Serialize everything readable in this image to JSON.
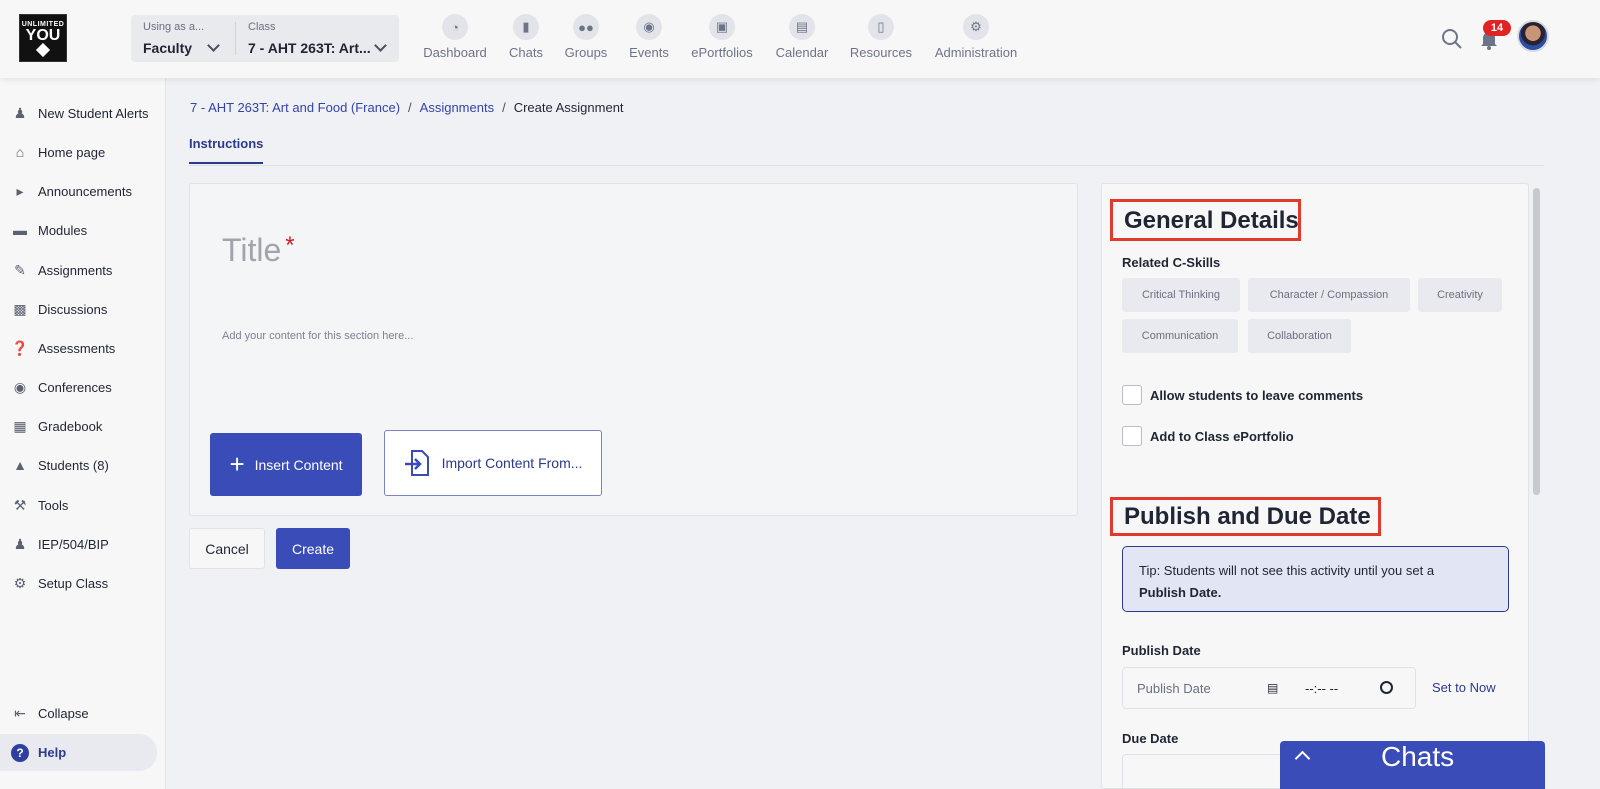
{
  "logo": {
    "line1": "UNLIMITED",
    "line2": "YOU"
  },
  "role_select": {
    "label": "Using as a...",
    "value": "Faculty"
  },
  "class_select": {
    "label": "Class",
    "value": "7 - AHT 263T: Art..."
  },
  "nav": [
    {
      "label": "Dashboard",
      "icon": "gauge-icon"
    },
    {
      "label": "Chats",
      "icon": "chat-icon"
    },
    {
      "label": "Groups",
      "icon": "groups-icon"
    },
    {
      "label": "Events",
      "icon": "pin-icon"
    },
    {
      "label": "ePortfolios",
      "icon": "portfolio-icon"
    },
    {
      "label": "Calendar",
      "icon": "calendar-icon"
    },
    {
      "label": "Resources",
      "icon": "books-icon"
    },
    {
      "label": "Administration",
      "icon": "gears-icon"
    }
  ],
  "notifications": {
    "count": "14"
  },
  "sidebar": {
    "items": [
      {
        "label": "New Student Alerts",
        "icon": "person-plus-icon"
      },
      {
        "label": "Home page",
        "icon": "home-icon"
      },
      {
        "label": "Announcements",
        "icon": "megaphone-icon"
      },
      {
        "label": "Modules",
        "icon": "module-icon"
      },
      {
        "label": "Assignments",
        "icon": "assignment-icon"
      },
      {
        "label": "Discussions",
        "icon": "discussion-icon"
      },
      {
        "label": "Assessments",
        "icon": "assessment-icon"
      },
      {
        "label": "Conferences",
        "icon": "conference-icon"
      },
      {
        "label": "Gradebook",
        "icon": "gradebook-icon"
      },
      {
        "label": "Students (8)",
        "icon": "graduation-cap-icon"
      },
      {
        "label": "Tools",
        "icon": "wrench-icon"
      },
      {
        "label": "IEP/504/BIP",
        "icon": "people-icon"
      },
      {
        "label": "Setup Class",
        "icon": "gear-icon"
      }
    ],
    "collapse": "Collapse",
    "help": "Help"
  },
  "breadcrumb": {
    "class": "7 - AHT 263T: Art and Food (France)",
    "section": "Assignments",
    "current": "Create Assignment",
    "separator": "/"
  },
  "tabs": {
    "instructions": "Instructions"
  },
  "editor": {
    "title_placeholder": "Title",
    "required_mark": "*",
    "content_placeholder": "Add your content for this section here...",
    "insert_label": "Insert Content",
    "import_label": "Import Content From..."
  },
  "actions": {
    "cancel": "Cancel",
    "create": "Create"
  },
  "general": {
    "heading": "General Details",
    "skills_label": "Related C-Skills",
    "skills": [
      "Critical Thinking",
      "Character / Compassion",
      "Creativity",
      "Communication",
      "Collaboration"
    ],
    "allow_comments": "Allow students to leave comments",
    "add_portfolio": "Add to Class ePortfolio"
  },
  "publish": {
    "heading": "Publish and Due Date",
    "tip_text": "Tip: Students will not see this activity until you set a",
    "tip_bold": "Publish Date.",
    "publish_label": "Publish Date",
    "publish_placeholder": "Publish Date",
    "time_placeholder": "--:-- --",
    "set_now": "Set to Now",
    "due_label": "Due Date"
  },
  "chats_bar": {
    "label": "Chats"
  },
  "colors": {
    "accent": "#3a4cb8",
    "highlight_box": "#e03a2c",
    "badge": "#e02424"
  }
}
